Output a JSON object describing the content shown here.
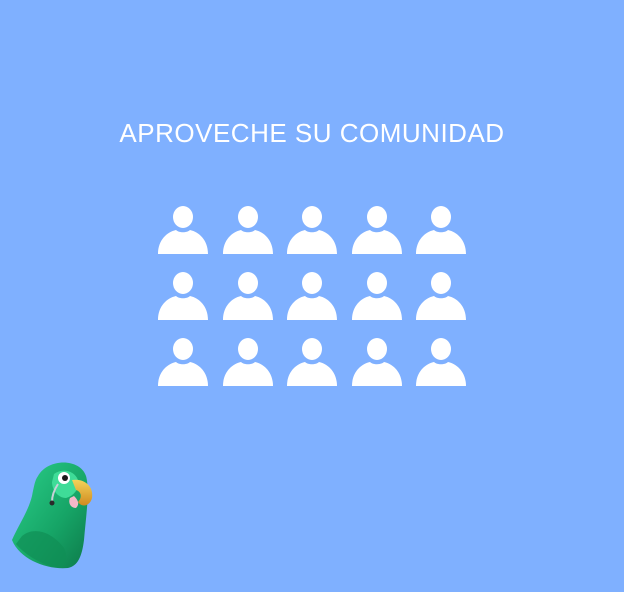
{
  "headline": "APROVECHE SU COMUNIDAD",
  "colors": {
    "background": "#7fb0ff",
    "text": "#ffffff",
    "icon": "#ffffff",
    "mascot_body": "#1fae6e",
    "mascot_beak": "#e8b23a"
  },
  "community": {
    "icon": "person-icon",
    "rows": 3,
    "columns": 5
  },
  "mascot": {
    "icon": "parrot-icon"
  }
}
